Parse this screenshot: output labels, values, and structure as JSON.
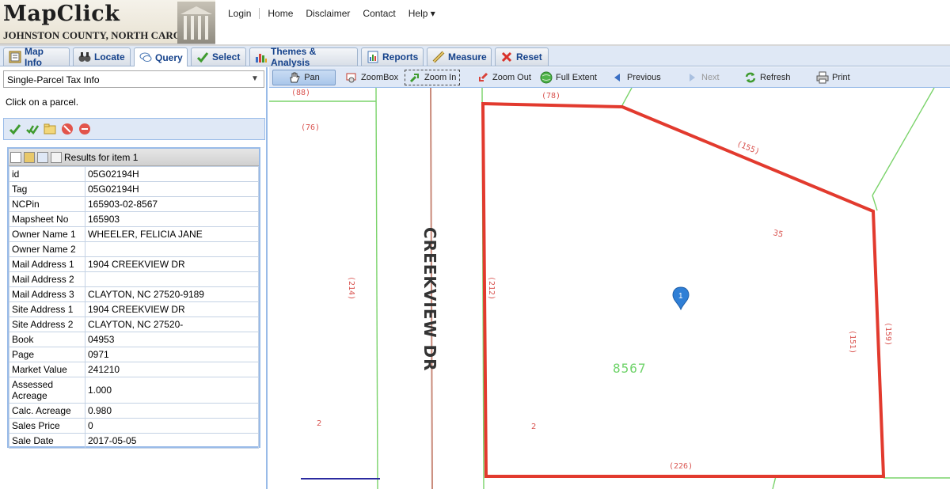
{
  "header": {
    "logo_title": "MapClick",
    "logo_subtitle": "JOHNSTON COUNTY, NORTH CAROLINA",
    "nav": [
      "Login",
      "Home",
      "Disclaimer",
      "Contact",
      "Help ▾"
    ]
  },
  "tabs": [
    {
      "label": "Map Info",
      "icon": "map-info-icon"
    },
    {
      "label": "Locate",
      "icon": "binoculars-icon"
    },
    {
      "label": "Query",
      "icon": "speech-bubble-icon"
    },
    {
      "label": "Select",
      "icon": "checkmark-icon"
    },
    {
      "label": "Themes & Analysis",
      "icon": "bar-chart-icon"
    },
    {
      "label": "Reports",
      "icon": "report-icon"
    },
    {
      "label": "Measure",
      "icon": "ruler-icon"
    },
    {
      "label": "Reset",
      "icon": "red-x-icon"
    }
  ],
  "query": {
    "selected_query": "Single-Parcel Tax Info",
    "instructions": "Click on a parcel."
  },
  "results": {
    "title": "Results for item 1",
    "rows": [
      {
        "key": "id",
        "value": "05G02194H"
      },
      {
        "key": "Tag",
        "value": "05G02194H"
      },
      {
        "key": "NCPin",
        "value": "165903-02-8567"
      },
      {
        "key": "Mapsheet No",
        "value": "165903"
      },
      {
        "key": "Owner Name 1",
        "value": "WHEELER, FELICIA JANE"
      },
      {
        "key": "Owner Name 2",
        "value": ""
      },
      {
        "key": "Mail Address 1",
        "value": "1904 CREEKVIEW DR"
      },
      {
        "key": "Mail Address 2",
        "value": ""
      },
      {
        "key": "Mail Address 3",
        "value": "CLAYTON, NC 27520-9189"
      },
      {
        "key": "Site Address 1",
        "value": "1904 CREEKVIEW DR"
      },
      {
        "key": "Site Address 2",
        "value": "CLAYTON, NC 27520-"
      },
      {
        "key": "Book",
        "value": "04953"
      },
      {
        "key": "Page",
        "value": "0971"
      },
      {
        "key": "Market Value",
        "value": "241210"
      },
      {
        "key": "Assessed Acreage",
        "value": "1.000"
      },
      {
        "key": "Calc. Acreage",
        "value": "0.980"
      },
      {
        "key": "Sales Price",
        "value": "0"
      },
      {
        "key": "Sale Date",
        "value": "2017-05-05"
      }
    ]
  },
  "map_toolbar": {
    "pan": "Pan",
    "zoombox": "ZoomBox",
    "zoom_in": "Zoom In",
    "zoom_out": "Zoom Out",
    "full_extent": "Full Extent",
    "previous": "Previous",
    "next": "Next",
    "refresh": "Refresh",
    "print": "Print"
  },
  "map": {
    "street_label": "CREEKVIEW DR",
    "parcel_number": "8567",
    "marker_label": "1",
    "lot_labels": [
      "35",
      "2",
      "2"
    ],
    "dimension_labels": [
      "(88)",
      "(76)",
      "(214)",
      "(78)",
      "(155)",
      "(212)",
      "(151)",
      "(159)",
      "(226)"
    ],
    "colors": {
      "parcel_outline": "#e23a2e",
      "parcel_lines": "#7ad36a",
      "labels": "#d9534f",
      "street": "#c98a7a",
      "marker": "#2f7fd6"
    }
  }
}
